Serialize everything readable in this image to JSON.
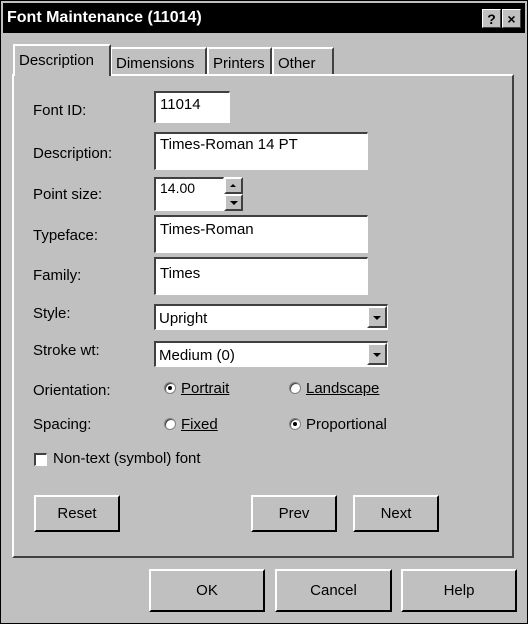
{
  "window": {
    "title": "Font Maintenance (11014)",
    "help_glyph": "?",
    "close_glyph": "×"
  },
  "tabs": [
    {
      "label": "Description",
      "active": true
    },
    {
      "label": "Dimensions",
      "active": false
    },
    {
      "label": "Printers",
      "active": false
    },
    {
      "label": "Other",
      "active": false
    }
  ],
  "form": {
    "font_id": {
      "label": "Font ID:",
      "value": "11014"
    },
    "description": {
      "label": "Description:",
      "value": "Times-Roman 14 PT"
    },
    "point_size": {
      "label": "Point size:",
      "value": "14.00"
    },
    "typeface": {
      "label": "Typeface:",
      "value": "Times-Roman"
    },
    "family": {
      "label": "Family:",
      "value": "Times"
    },
    "style": {
      "label": "Style:",
      "value": "Upright"
    },
    "stroke_wt": {
      "label": "Stroke wt:",
      "value": "Medium (0)"
    },
    "orientation": {
      "label": "Orientation:",
      "options": [
        "Portrait",
        "Landscape"
      ],
      "selected": "Portrait"
    },
    "spacing": {
      "label": "Spacing:",
      "options": [
        "Fixed",
        "Proportional"
      ],
      "selected": "Proportional"
    },
    "non_text": {
      "label": "Non-text (symbol) font",
      "checked": false
    }
  },
  "panel_buttons": {
    "reset": "Reset",
    "prev": "Prev",
    "next": "Next"
  },
  "footer_buttons": {
    "ok": "OK",
    "cancel": "Cancel",
    "help": "Help"
  }
}
